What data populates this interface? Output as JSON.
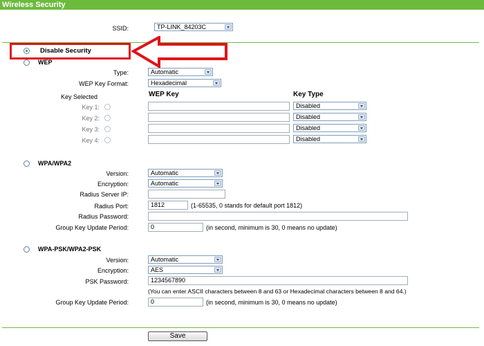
{
  "header": {
    "title": "Wireless Security"
  },
  "ssid": {
    "label": "SSID:",
    "value": "TP-LINK_84203C"
  },
  "disable_security": {
    "label": "Disable Security",
    "selected": true
  },
  "wep": {
    "label": "WEP",
    "type_label": "Type:",
    "type_value": "Automatic",
    "format_label": "WEP Key Format:",
    "format_value": "Hexadecimal",
    "col_key_selected": "Key Selected",
    "col_wep_key": "WEP Key",
    "col_key_type": "Key Type",
    "keys": [
      {
        "label": "Key 1:",
        "value": "",
        "type": "Disabled"
      },
      {
        "label": "Key 2:",
        "value": "",
        "type": "Disabled"
      },
      {
        "label": "Key 3:",
        "value": "",
        "type": "Disabled"
      },
      {
        "label": "Key 4:",
        "value": "",
        "type": "Disabled"
      }
    ]
  },
  "wpa": {
    "label": "WPA/WPA2",
    "version_label": "Version:",
    "version_value": "Automatic",
    "encryption_label": "Encryption:",
    "encryption_value": "Automatic",
    "radius_ip_label": "Radius Server IP:",
    "radius_ip_value": "",
    "radius_port_label": "Radius Port:",
    "radius_port_value": "1812",
    "radius_port_hint": "(1-65535, 0 stands for default port 1812)",
    "radius_password_label": "Radius Password:",
    "radius_password_value": "",
    "group_key_label": "Group Key Update Period:",
    "group_key_value": "0",
    "group_key_hint": "(in second, minimum is 30, 0 means no update)"
  },
  "wpa_psk": {
    "label": "WPA-PSK/WPA2-PSK",
    "version_label": "Version:",
    "version_value": "Automatic",
    "encryption_label": "Encryption:",
    "encryption_value": "AES",
    "psk_label": "PSK Password:",
    "psk_value": "1234567890",
    "psk_hint": "(You can enter ASCII characters between 8 and 63 or Hexadecimal characters between 8 and 64.)",
    "group_key_label": "Group Key Update Period:",
    "group_key_value": "0",
    "group_key_hint": "(in second, minimum is 30, 0 means no update)"
  },
  "save_label": "Save",
  "colors": {
    "header": "#6cbb3d",
    "highlight": "#e0141a"
  }
}
